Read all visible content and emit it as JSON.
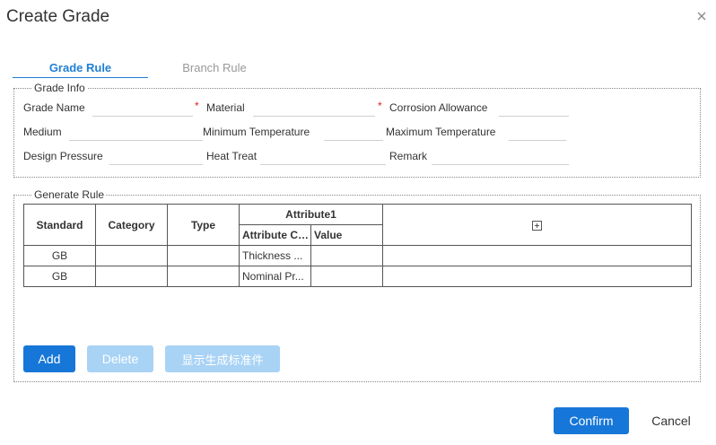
{
  "dialog": {
    "title": "Create Grade"
  },
  "tabs": [
    {
      "label": "Grade Rule",
      "active": true
    },
    {
      "label": "Branch Rule",
      "active": false
    }
  ],
  "grade_info": {
    "legend": "Grade Info",
    "required_mark": "*",
    "fields": {
      "grade_name": {
        "label": "Grade Name",
        "value": ""
      },
      "material": {
        "label": "Material",
        "value": ""
      },
      "corrosion_allowance": {
        "label": "Corrosion Allowance",
        "value": ""
      },
      "medium": {
        "label": "Medium",
        "value": ""
      },
      "minimum_temperature": {
        "label": "Minimum Temperature",
        "value": ""
      },
      "maximum_temperature": {
        "label": "Maximum Temperature",
        "value": ""
      },
      "design_pressure": {
        "label": "Design Pressure",
        "value": ""
      },
      "heat_treat": {
        "label": "Heat Treat",
        "value": ""
      },
      "remark": {
        "label": "Remark",
        "value": ""
      }
    }
  },
  "generate_rule": {
    "legend": "Generate Rule",
    "headers": {
      "standard": "Standard",
      "category": "Category",
      "type": "Type",
      "attribute1": "Attribute1",
      "attribute_category": "Attribute Category",
      "value": "Value"
    },
    "rows": [
      {
        "standard": "GB",
        "category": "",
        "type": "",
        "attribute_category": "Thickness ...",
        "value": ""
      },
      {
        "standard": "GB",
        "category": "",
        "type": "",
        "attribute_category": "Nominal Pr...",
        "value": ""
      }
    ],
    "buttons": {
      "add": "Add",
      "delete": "Delete",
      "show_generated": "显示生成标准件"
    }
  },
  "footer": {
    "confirm": "Confirm",
    "cancel": "Cancel"
  },
  "colors": {
    "primary": "#1777d8",
    "tab_active": "#1f7fd6",
    "disabled": "#a9d3f5",
    "required": "#e02020"
  }
}
